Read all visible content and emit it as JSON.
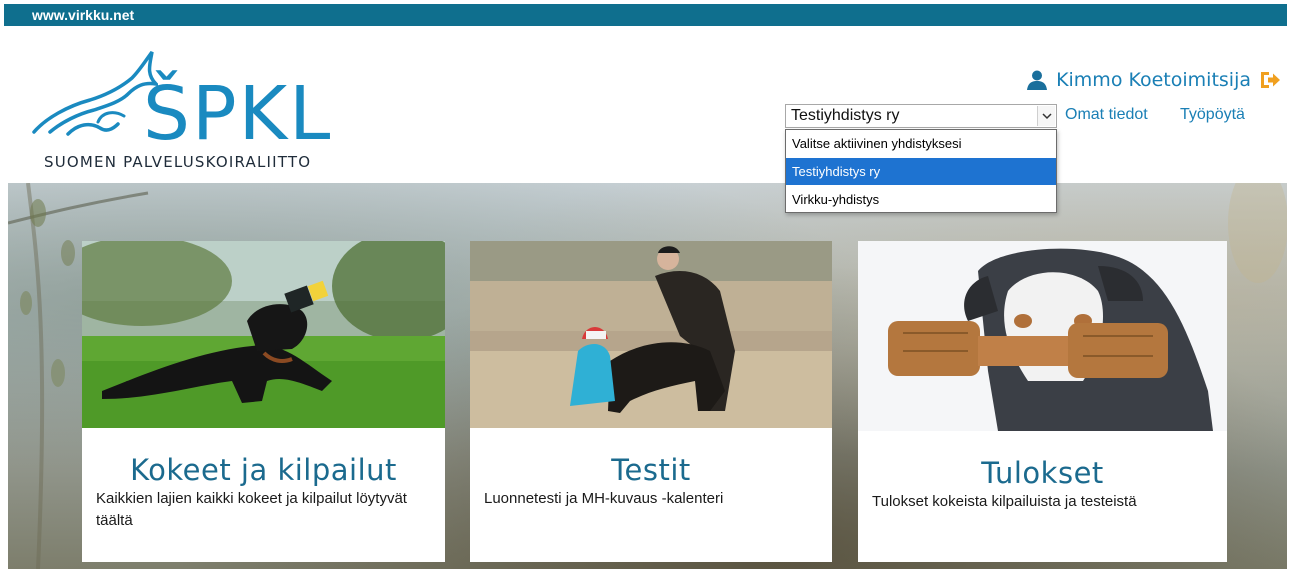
{
  "topbar": {
    "site": "www.virkku.net"
  },
  "logo": {
    "letters": "ŠPKL",
    "subtitle": "SUOMEN PALVELUSKOIRALIITTO"
  },
  "user": {
    "name": "Kimmo Koetoimitsija"
  },
  "association_select": {
    "value": "Testiyhdistys ry",
    "options": [
      "Valitse aktiivinen yhdistyksesi",
      "Testiyhdistys ry",
      "Virkku-yhdistys"
    ],
    "selected_index": 1
  },
  "nav": {
    "own_info": "Omat tiedot",
    "desktop": "Työpöytä"
  },
  "cards": [
    {
      "title": "Kokeet ja kilpailut",
      "desc": "Kaikkien lajien kaikki kokeet ja kilpailut löytyvät täältä"
    },
    {
      "title": "Testit",
      "desc": "Luonnetesti ja MH-kuvaus -kalenteri"
    },
    {
      "title": "Tulokset",
      "desc": "Tulokset kokeista kilpailuista ja testeistä"
    }
  ],
  "colors": {
    "topbar": "#0f6f8e",
    "accent": "#1a7fb5",
    "logout": "#f0a020",
    "selection": "#1e73d1"
  },
  "icons": {
    "user": "user-icon",
    "logout": "logout-icon",
    "dropdown": "chevron-down-icon"
  }
}
